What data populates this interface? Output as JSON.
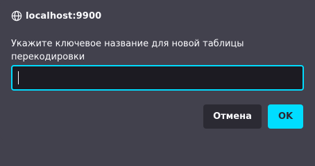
{
  "dialog": {
    "origin": "localhost:9900",
    "origin_icon": "globe-icon",
    "message": "Укажите ключевое название для новой таблицы перекодировки",
    "input_value": "",
    "buttons": {
      "cancel_label": "Отмена",
      "ok_label": "OK"
    }
  },
  "colors": {
    "background": "#42414d",
    "input_background": "#1c1b22",
    "accent": "#00ddff",
    "cancel_button": "#2b2a33",
    "text": "#fbfbfe"
  }
}
